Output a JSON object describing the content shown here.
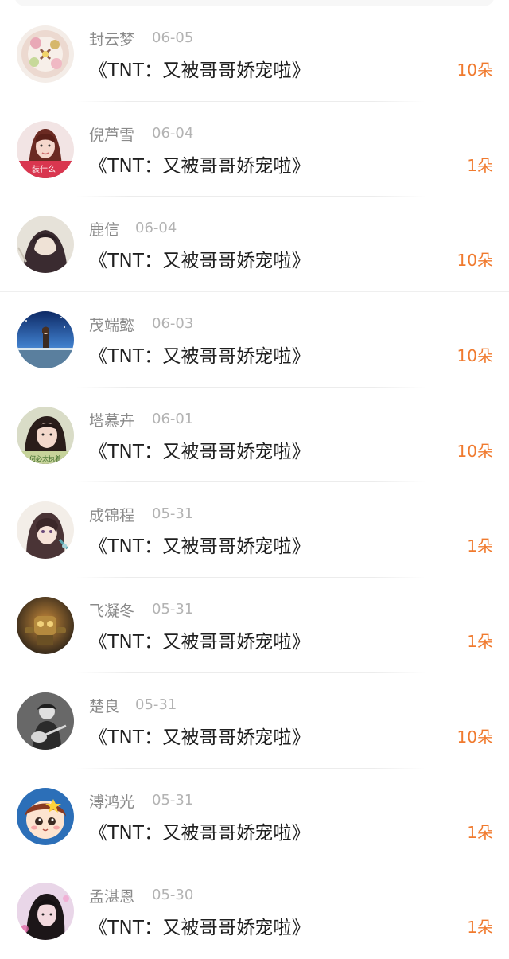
{
  "gifts": [
    {
      "name": "封云梦",
      "date": "06-05",
      "title": "《TNT：又被哥哥娇宠啦》",
      "count": "10朵",
      "avatar": "cake-avatar"
    },
    {
      "name": "倪芦雪",
      "date": "06-04",
      "title": "《TNT：又被哥哥娇宠啦》",
      "count": "1朵",
      "avatar": "girl-avatar",
      "avatar_caption": "装什么"
    },
    {
      "name": "鹿信",
      "date": "06-04",
      "title": "《TNT：又被哥哥娇宠啦》",
      "count": "10朵",
      "avatar": "hooded-figure-avatar"
    },
    {
      "name": "茂端懿",
      "date": "06-03",
      "title": "《TNT：又被哥哥娇宠啦》",
      "count": "10朵",
      "avatar": "anime-night-avatar"
    },
    {
      "name": "塔慕卉",
      "date": "06-01",
      "title": "《TNT：又被哥哥娇宠啦》",
      "count": "10朵",
      "avatar": "girl-photo-avatar",
      "avatar_caption": "何必太执着"
    },
    {
      "name": "成锦程",
      "date": "05-31",
      "title": "《TNT：又被哥哥娇宠啦》",
      "count": "1朵",
      "avatar": "anime-girl-avatar"
    },
    {
      "name": "飞凝冬",
      "date": "05-31",
      "title": "《TNT：又被哥哥娇宠啦》",
      "count": "1朵",
      "avatar": "robot-avatar"
    },
    {
      "name": "楚良",
      "date": "05-31",
      "title": "《TNT：又被哥哥娇宠啦》",
      "count": "10朵",
      "avatar": "guitar-avatar"
    },
    {
      "name": "溥鸿光",
      "date": "05-31",
      "title": "《TNT：又被哥哥娇宠啦》",
      "count": "1朵",
      "avatar": "cartoon-face-avatar"
    },
    {
      "name": "孟湛恩",
      "date": "05-30",
      "title": "《TNT：又被哥哥娇宠啦》",
      "count": "1朵",
      "avatar": "pink-photo-avatar"
    }
  ],
  "colors": {
    "accent": "#f07a2e",
    "name": "#8a8a8a",
    "date": "#b3b3b3",
    "title": "#1f1f1f"
  }
}
